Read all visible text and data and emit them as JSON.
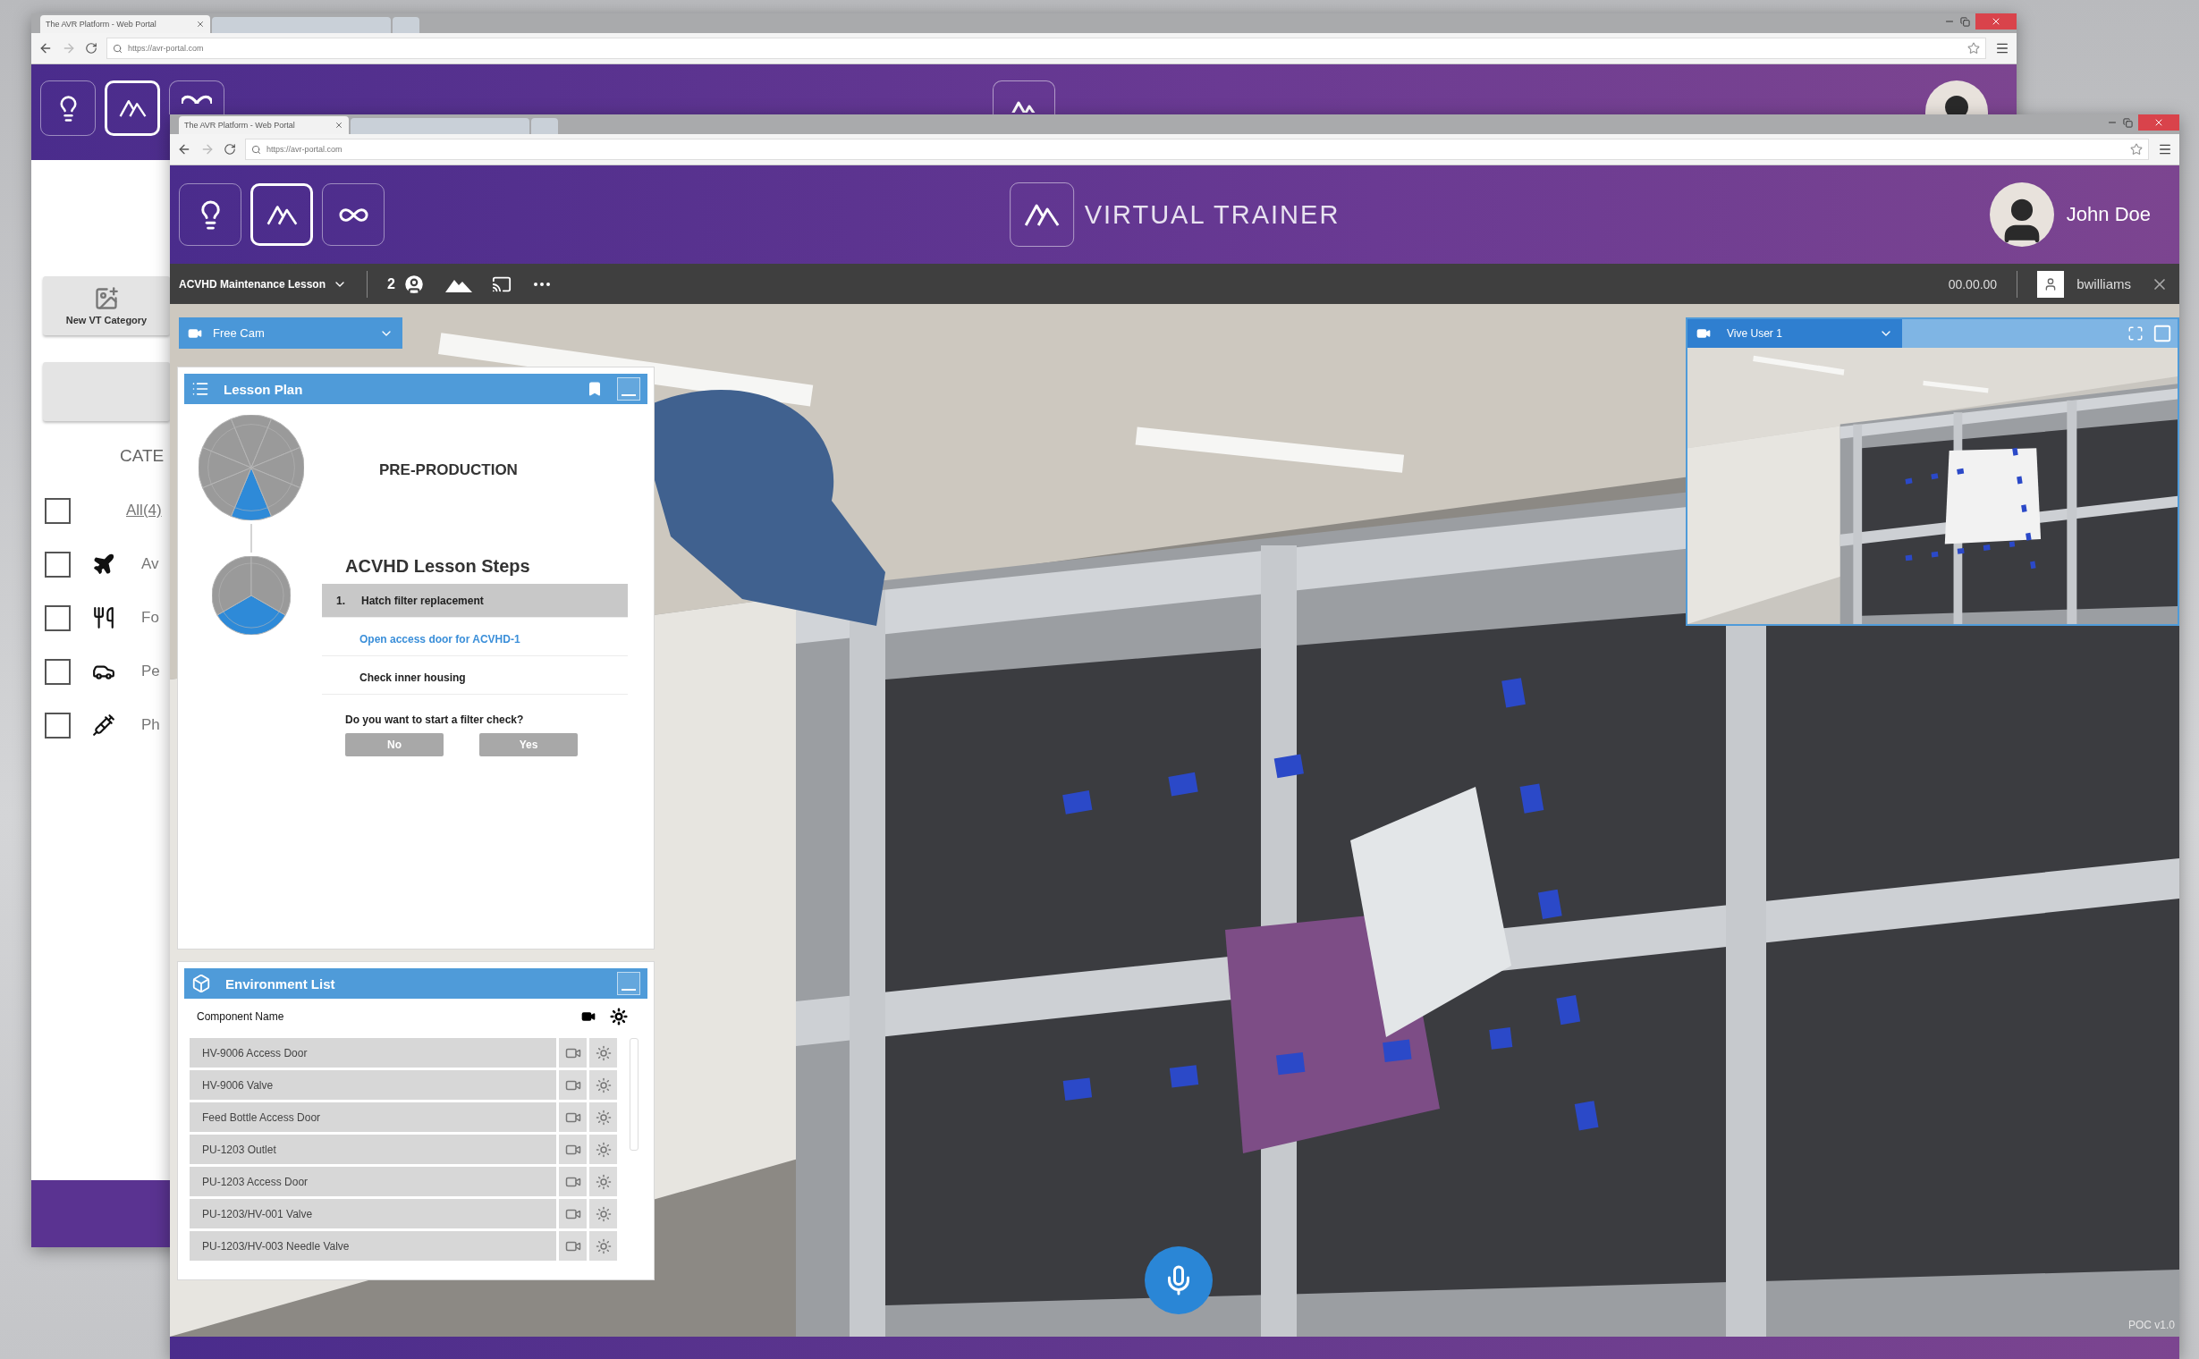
{
  "back_window": {
    "tab_title": "The AVR Platform - Web Portal",
    "url": "https://avr-portal.com",
    "apps": [
      {
        "kind": "idea",
        "selected": false
      },
      {
        "kind": "trainer",
        "selected": true
      },
      {
        "kind": "link",
        "selected": false
      }
    ],
    "sidebar": {
      "new_button": "New VT Category",
      "heading": "CATE",
      "categories": [
        {
          "kind": "all",
          "label": "All(4)",
          "checked": false
        },
        {
          "kind": "aviation",
          "label": "Av",
          "checked": false
        },
        {
          "kind": "food",
          "label": "Fo",
          "checked": false
        },
        {
          "kind": "vehicle",
          "label": "Pe",
          "checked": false
        },
        {
          "kind": "pharma",
          "label": "Ph",
          "checked": false
        }
      ]
    }
  },
  "front_window": {
    "tab_title": "The AVR Platform - Web Portal",
    "url": "https://avr-portal.com",
    "apps": [
      {
        "kind": "idea",
        "selected": false
      },
      {
        "kind": "trainer",
        "selected": true
      },
      {
        "kind": "link",
        "selected": false
      }
    ],
    "title": "VIRTUAL TRAINER",
    "user_name": "John Doe",
    "toolbar": {
      "lesson": "ACVHD Maintenance Lesson",
      "participants": "2",
      "timer": "00.00.00",
      "user": "bwilliams"
    },
    "camera": "Free Cam",
    "lesson_plan": {
      "title": "Lesson Plan",
      "stages": [
        {
          "title": "PRE-PRODUCTION",
          "segments": [
            {
              "done": true
            },
            {
              "done": false
            },
            {
              "done": false
            },
            {
              "done": false
            },
            {
              "done": false
            },
            {
              "done": false
            },
            {
              "done": false
            },
            {
              "done": false
            }
          ]
        },
        {
          "title": "ACVHD Lesson Steps",
          "segments": [
            {
              "done": true
            },
            {
              "done": false
            },
            {
              "done": false
            }
          ]
        }
      ],
      "steps": [
        {
          "number": "1.",
          "label": "Hatch filter replacement",
          "selected": true,
          "current": false
        },
        {
          "label": "Open access door for ACVHD-1",
          "selected": false,
          "current": true
        },
        {
          "label": "Check inner housing",
          "selected": false,
          "current": false
        }
      ],
      "question": "Do you want to start a filter check?",
      "buttons": [
        "No",
        "Yes"
      ]
    },
    "environment_list": {
      "title": "Environment List",
      "column": "Component Name",
      "rows": [
        "HV-9006 Access Door",
        "HV-9006 Valve",
        "Feed Bottle Access Door",
        "PU-1203 Outlet",
        "PU-1203 Access Door",
        "PU-1203/HV-001 Valve",
        "PU-1203/HV-003 Needle Valve"
      ]
    },
    "viewer": {
      "title": "Vive User 1"
    },
    "version": "POC v1.0"
  }
}
